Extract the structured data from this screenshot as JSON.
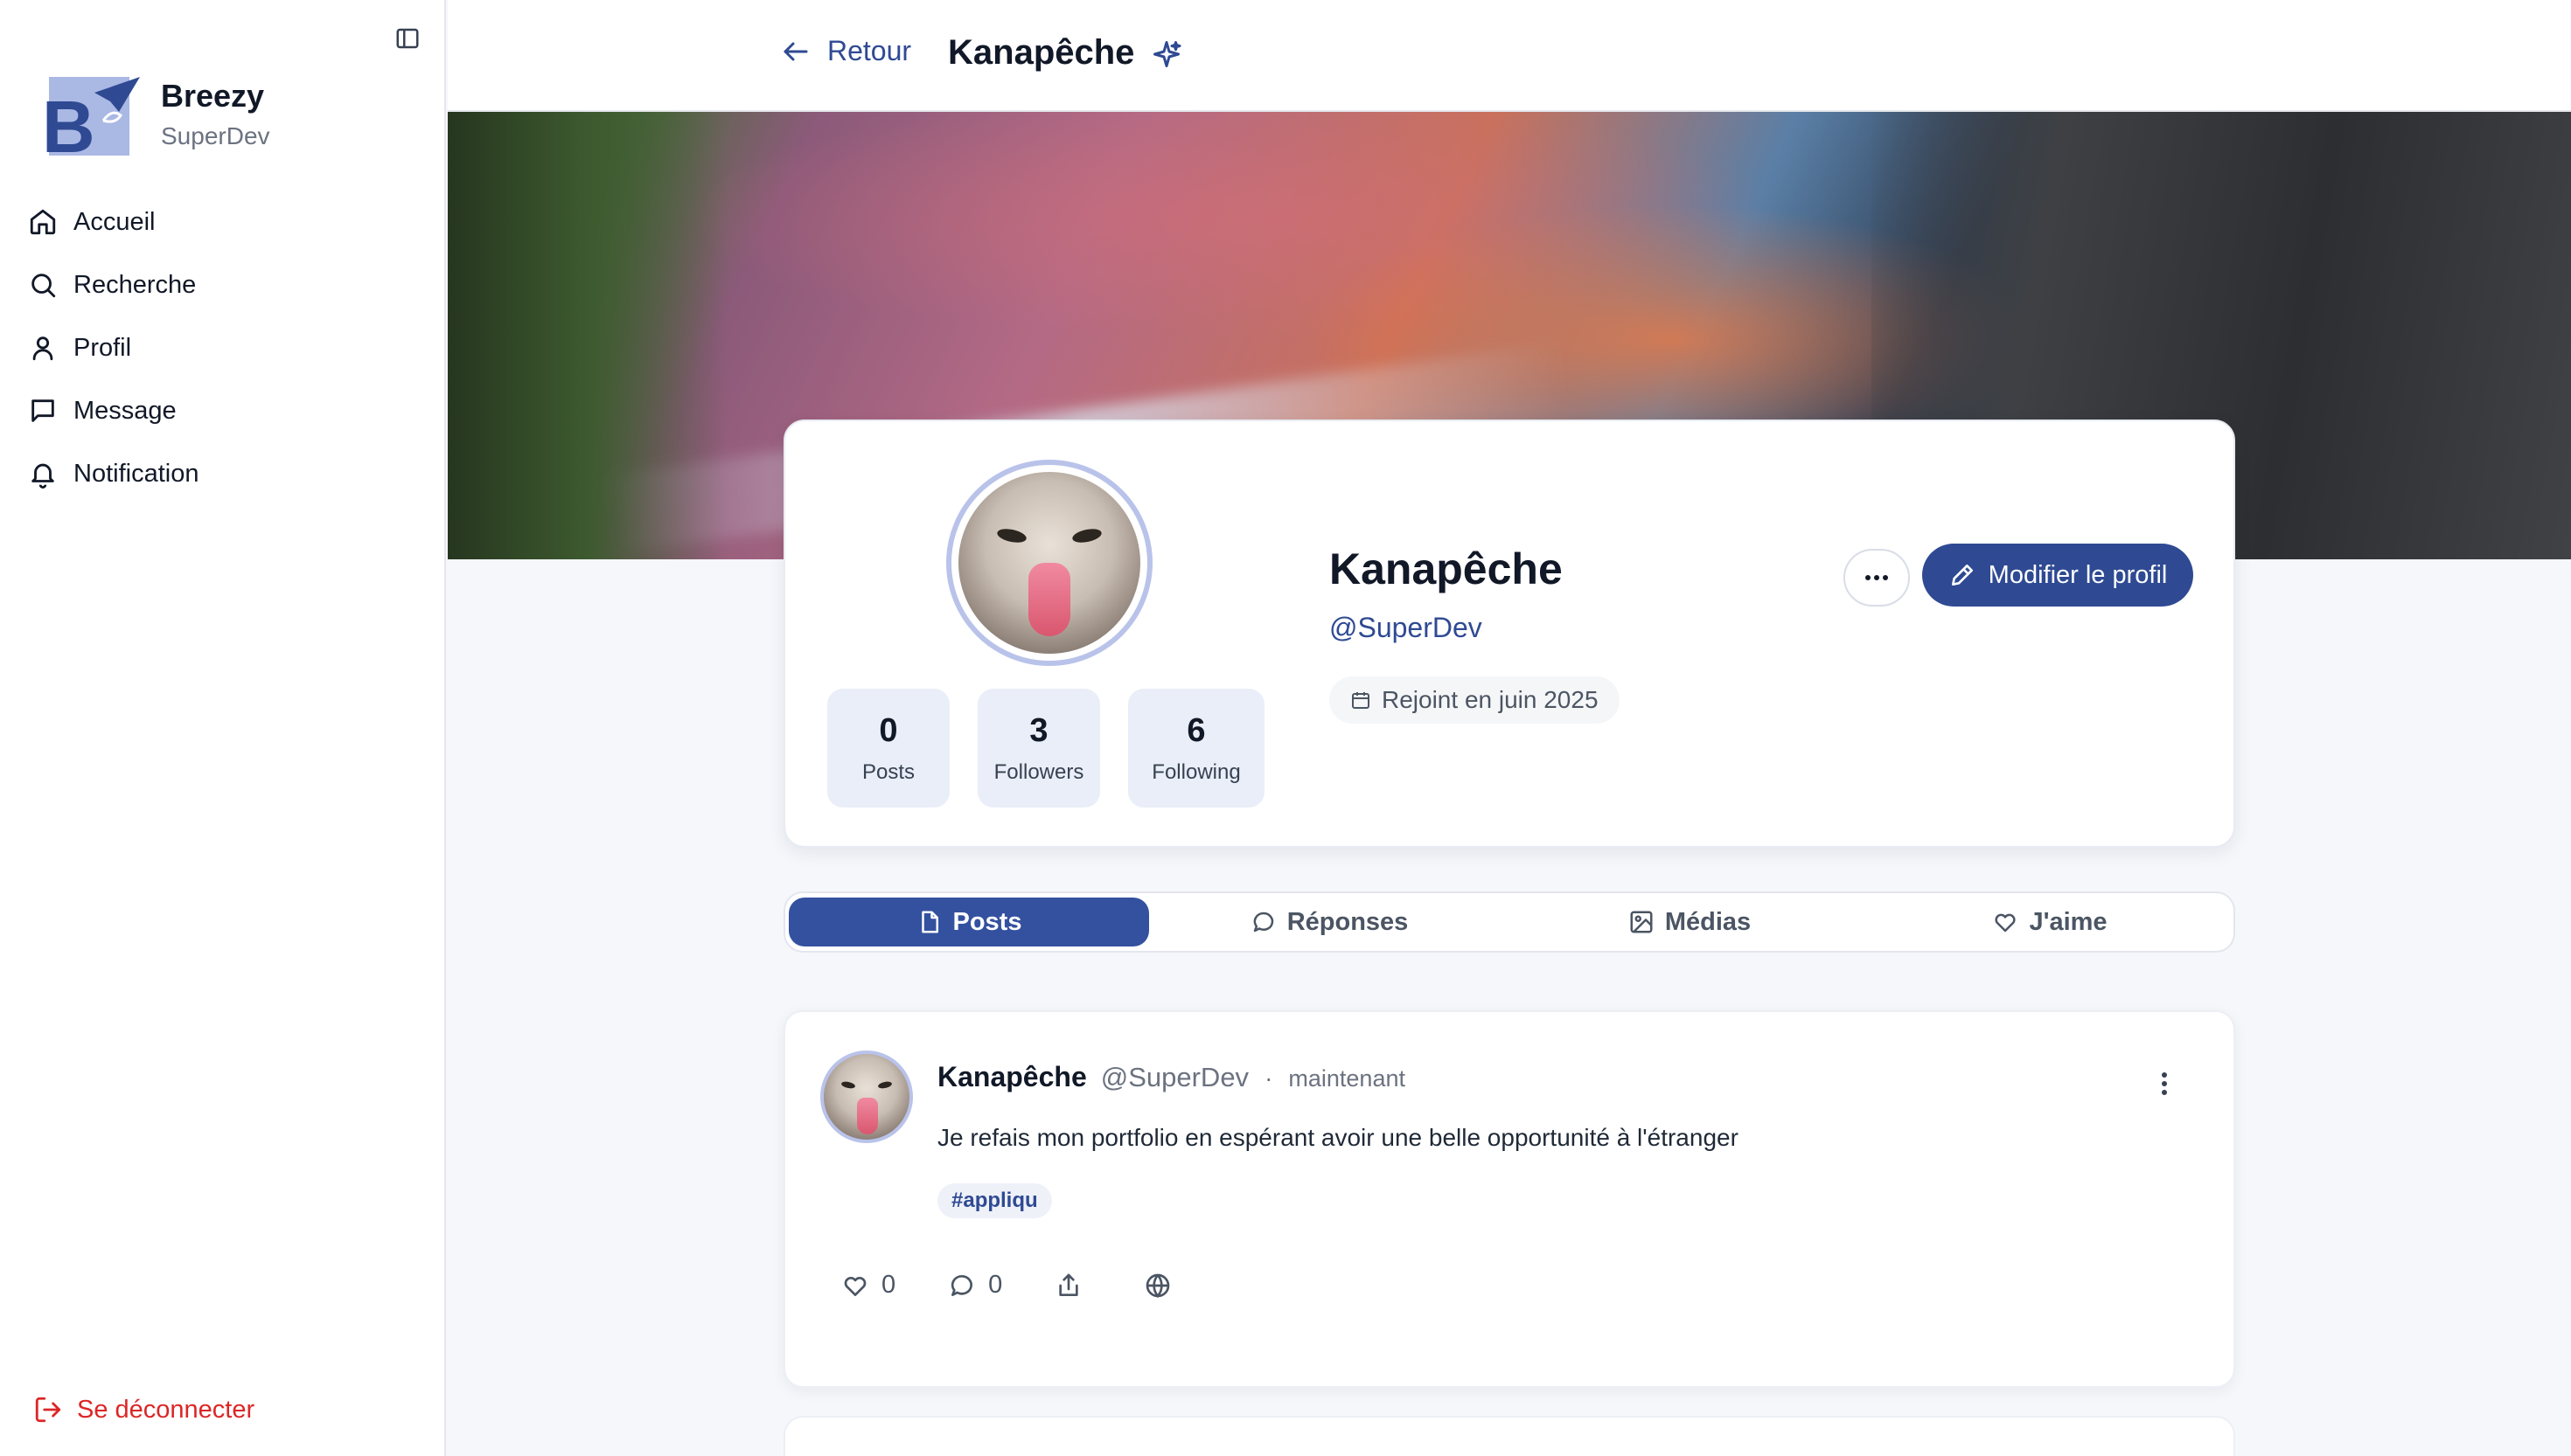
{
  "sidebar": {
    "brand": {
      "name": "Breezy",
      "subtitle": "SuperDev"
    },
    "items": [
      {
        "label": "Accueil",
        "icon": "home-icon"
      },
      {
        "label": "Recherche",
        "icon": "search-icon"
      },
      {
        "label": "Profil",
        "icon": "user-icon"
      },
      {
        "label": "Message",
        "icon": "message-icon"
      },
      {
        "label": "Notification",
        "icon": "bell-icon"
      }
    ],
    "logout_label": "Se déconnecter"
  },
  "header": {
    "back_label": "Retour",
    "title": "Kanapêche"
  },
  "profile": {
    "name": "Kanapêche",
    "handle": "@SuperDev",
    "joined": "Rejoint en juin 2025",
    "edit_label": "Modifier le profil",
    "more_label": "···",
    "stats": [
      {
        "value": "0",
        "label": "Posts"
      },
      {
        "value": "3",
        "label": "Followers"
      },
      {
        "value": "6",
        "label": "Following"
      }
    ]
  },
  "tabs": [
    {
      "label": "Posts",
      "active": true
    },
    {
      "label": "Réponses",
      "active": false
    },
    {
      "label": "Médias",
      "active": false
    },
    {
      "label": "J'aime",
      "active": false
    }
  ],
  "post": {
    "author": "Kanapêche",
    "handle": "@SuperDev",
    "separator": "·",
    "time": "maintenant",
    "text": "Je refais mon portfolio en espérant avoir une belle opportunité à l'étranger",
    "hashtag": "#appliqu",
    "likes": "0",
    "comments": "0"
  },
  "colors": {
    "accent": "#2f4a93",
    "danger": "#dc2626",
    "stat_bg": "#e9eef8"
  }
}
